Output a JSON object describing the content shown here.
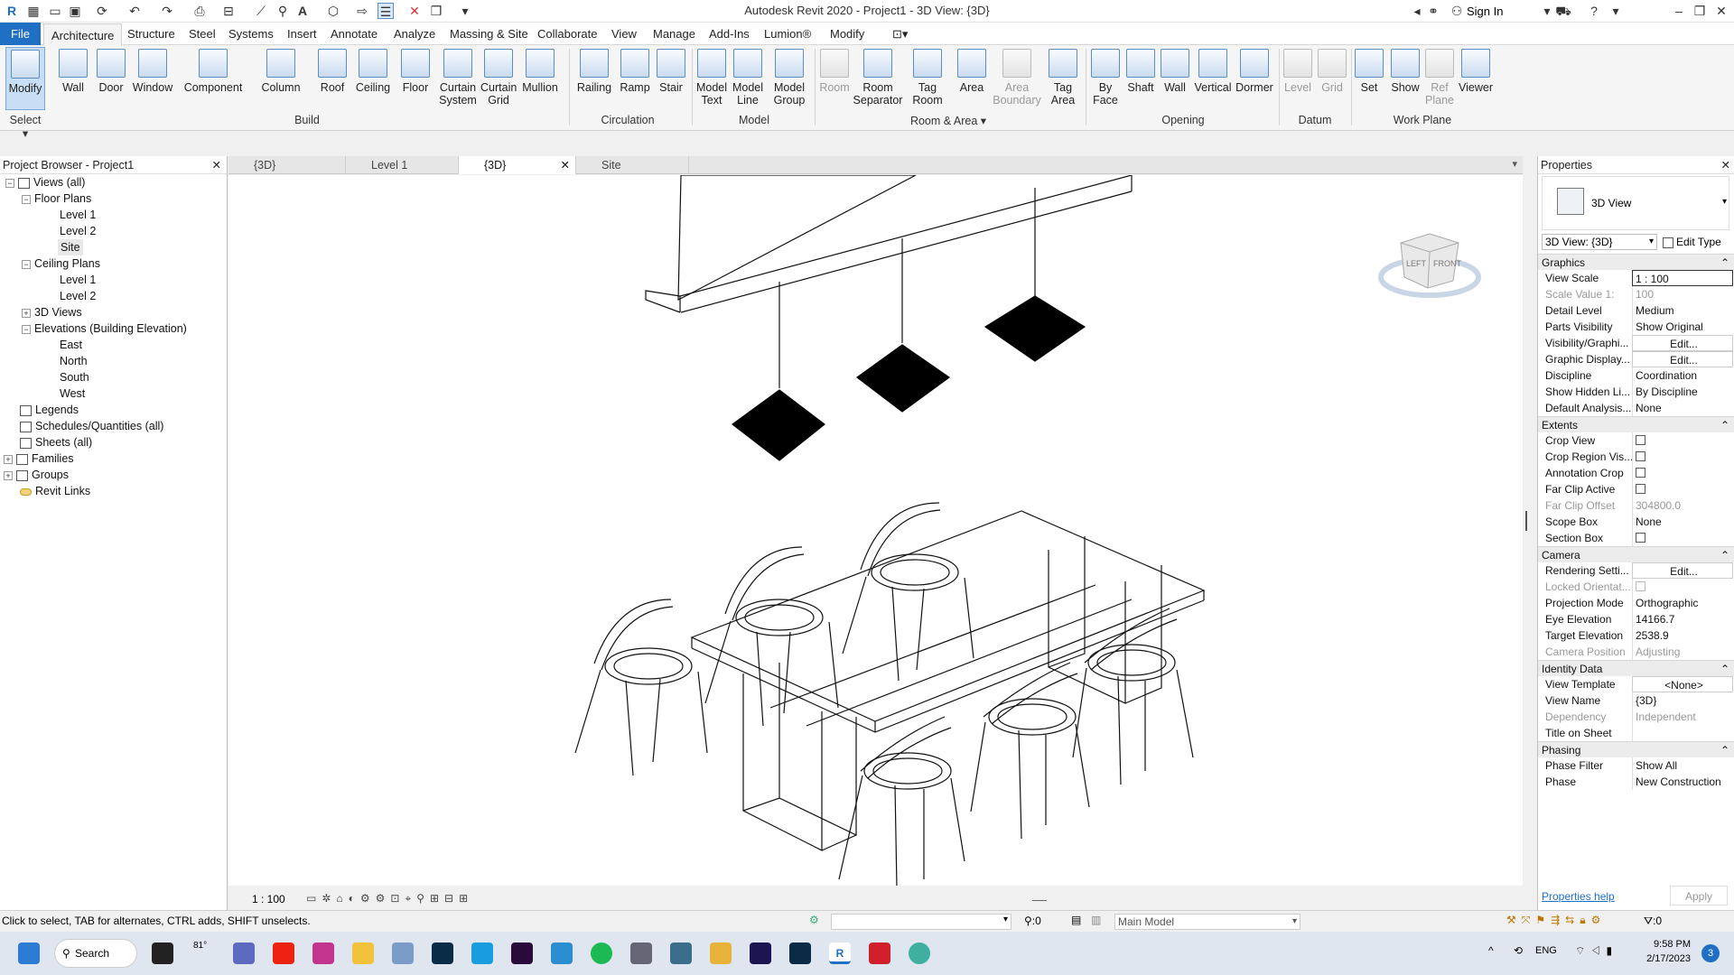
{
  "app": {
    "title": "Autodesk Revit 2020 - Project1 - 3D View: {3D}",
    "sign_in": "Sign In"
  },
  "menu": [
    "File",
    "Architecture",
    "Structure",
    "Steel",
    "Systems",
    "Insert",
    "Annotate",
    "Analyze",
    "Massing & Site",
    "Collaborate",
    "View",
    "Manage",
    "Add-Ins",
    "Lumion®",
    "Modify"
  ],
  "ribbon": {
    "buttons": [
      {
        "label": "Modify",
        "icon": "cursor-icon"
      },
      {
        "label": "Wall",
        "icon": "wall-icon"
      },
      {
        "label": "Door",
        "icon": "door-icon"
      },
      {
        "label": "Window",
        "icon": "window-icon"
      },
      {
        "label": "Component",
        "icon": "component-icon"
      },
      {
        "label": "Column",
        "icon": "column-icon"
      },
      {
        "label": "Roof",
        "icon": "roof-icon"
      },
      {
        "label": "Ceiling",
        "icon": "ceiling-icon"
      },
      {
        "label": "Floor",
        "icon": "floor-icon"
      },
      {
        "label": "Curtain System",
        "icon": "curtain-system-icon"
      },
      {
        "label": "Curtain Grid",
        "icon": "curtain-grid-icon"
      },
      {
        "label": "Mullion",
        "icon": "mullion-icon"
      },
      {
        "label": "Railing",
        "icon": "railing-icon"
      },
      {
        "label": "Ramp",
        "icon": "ramp-icon"
      },
      {
        "label": "Stair",
        "icon": "stair-icon"
      },
      {
        "label": "Model Text",
        "icon": "model-text-icon"
      },
      {
        "label": "Model Line",
        "icon": "model-line-icon"
      },
      {
        "label": "Model Group",
        "icon": "model-group-icon"
      },
      {
        "label": "Room",
        "icon": "room-icon"
      },
      {
        "label": "Room Separator",
        "icon": "room-separator-icon"
      },
      {
        "label": "Tag Room",
        "icon": "tag-room-icon"
      },
      {
        "label": "Area",
        "icon": "area-icon"
      },
      {
        "label": "Area Boundary",
        "icon": "area-boundary-icon"
      },
      {
        "label": "Tag Area",
        "icon": "tag-area-icon"
      },
      {
        "label": "By Face",
        "icon": "by-face-icon"
      },
      {
        "label": "Shaft",
        "icon": "shaft-icon"
      },
      {
        "label": "Wall",
        "icon": "wall-opening-icon"
      },
      {
        "label": "Vertical",
        "icon": "vertical-icon"
      },
      {
        "label": "Dormer",
        "icon": "dormer-icon"
      },
      {
        "label": "Level",
        "icon": "level-icon"
      },
      {
        "label": "Grid",
        "icon": "grid-icon"
      },
      {
        "label": "Set",
        "icon": "set-icon"
      },
      {
        "label": "Show",
        "icon": "show-icon"
      },
      {
        "label": "Ref Plane",
        "icon": "ref-plane-icon"
      },
      {
        "label": "Viewer",
        "icon": "viewer-icon"
      }
    ],
    "groups": [
      "Select",
      "Build",
      "Circulation",
      "Model",
      "Room & Area",
      "Opening",
      "Datum",
      "Work Plane"
    ]
  },
  "browser": {
    "title": "Project Browser - Project1",
    "items": [
      "Views (all)",
      "Floor Plans",
      "Level 1",
      "Level 2",
      "Site",
      "Ceiling Plans",
      "Level 1",
      "Level 2",
      "3D Views",
      "Elevations (Building Elevation)",
      "East",
      "North",
      "South",
      "West",
      "Legends",
      "Schedules/Quantities (all)",
      "Sheets (all)",
      "Families",
      "Groups",
      "Revit Links"
    ]
  },
  "tabs": [
    "{3D}",
    "Level 1",
    "{3D}",
    "Site"
  ],
  "viewbar": {
    "scale": "1 : 100"
  },
  "viewcube": {
    "left": "LEFT",
    "front": "FRONT"
  },
  "properties": {
    "title": "Properties",
    "type_name": "3D View",
    "selector": "3D View: {3D}",
    "edit_type": "Edit Type",
    "sections": [
      {
        "name": "Graphics",
        "rows": [
          [
            "View Scale",
            "1 : 100"
          ],
          [
            "Scale Value    1:",
            "100"
          ],
          [
            "Detail Level",
            "Medium"
          ],
          [
            "Parts Visibility",
            "Show Original"
          ],
          [
            "Visibility/Graphi...",
            "Edit..."
          ],
          [
            "Graphic Display...",
            "Edit..."
          ],
          [
            "Discipline",
            "Coordination"
          ],
          [
            "Show Hidden Li...",
            "By Discipline"
          ],
          [
            "Default Analysis...",
            "None"
          ]
        ]
      },
      {
        "name": "Extents",
        "rows": [
          [
            "Crop View",
            ""
          ],
          [
            "Crop Region Vis...",
            ""
          ],
          [
            "Annotation Crop",
            ""
          ],
          [
            "Far Clip Active",
            ""
          ],
          [
            "Far Clip Offset",
            "304800.0"
          ],
          [
            "Scope Box",
            "None"
          ],
          [
            "Section Box",
            ""
          ]
        ]
      },
      {
        "name": "Camera",
        "rows": [
          [
            "Rendering Setti...",
            "Edit..."
          ],
          [
            "Locked Orientat...",
            ""
          ],
          [
            "Projection Mode",
            "Orthographic"
          ],
          [
            "Eye Elevation",
            "14166.7"
          ],
          [
            "Target Elevation",
            "2538.9"
          ],
          [
            "Camera Position",
            "Adjusting"
          ]
        ]
      },
      {
        "name": "Identity Data",
        "rows": [
          [
            "View Template",
            "<None>"
          ],
          [
            "View Name",
            "{3D}"
          ],
          [
            "Dependency",
            "Independent"
          ],
          [
            "Title on Sheet",
            ""
          ]
        ]
      },
      {
        "name": "Phasing",
        "rows": [
          [
            "Phase Filter",
            "Show All"
          ],
          [
            "Phase",
            "New Construction"
          ]
        ]
      }
    ],
    "help": "Properties help",
    "apply": "Apply"
  },
  "status": {
    "text": "Click to select, TAB for alternates, CTRL adds, SHIFT unselects.",
    "zero": ":0",
    "model": "Main Model",
    "filter": ":0"
  },
  "taskbar": {
    "search": "Search",
    "temp": "81°",
    "lang": "ENG",
    "time": "9:58 PM",
    "date": "2/17/2023",
    "badge": "3"
  }
}
